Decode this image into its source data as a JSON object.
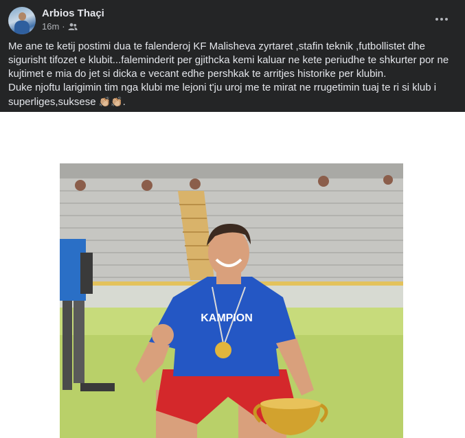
{
  "post": {
    "author": "Arbios Thaçi",
    "time": "16m",
    "separator": "·",
    "privacy_icon": "friends-icon",
    "more_icon": "more-dots-icon",
    "paragraphs": [
      "Me ane te ketij postimi dua te falenderoj KF Malisheva zyrtaret ,stafin teknik ,futbollistet dhe sigurisht tifozet e klubit...faleminderit per gjithcka kemi kaluar ne kete periudhe te shkurter por ne kujtimet e mia do jet si dicka e vecant edhe pershkak te arritjes historike per klubin.",
      "Duke njoftu larigimin tim nga klubi me lejoni t'ju uroj me te mirat ne rrugetimin tuaj te ri si klub i superliges,suksese"
    ],
    "emoji": "👏🏼👏🏼",
    "end_punct": ".",
    "photo": {
      "shirt_text": "KAMPION",
      "colors": {
        "shirt": "#2457c4",
        "shorts": "#d4282b",
        "grass": "#b9d069",
        "stand": "#c6c6c2"
      }
    }
  },
  "colors": {
    "header_bg": "#242526",
    "text": "#e4e6eb",
    "muted": "#b0b3b8"
  }
}
